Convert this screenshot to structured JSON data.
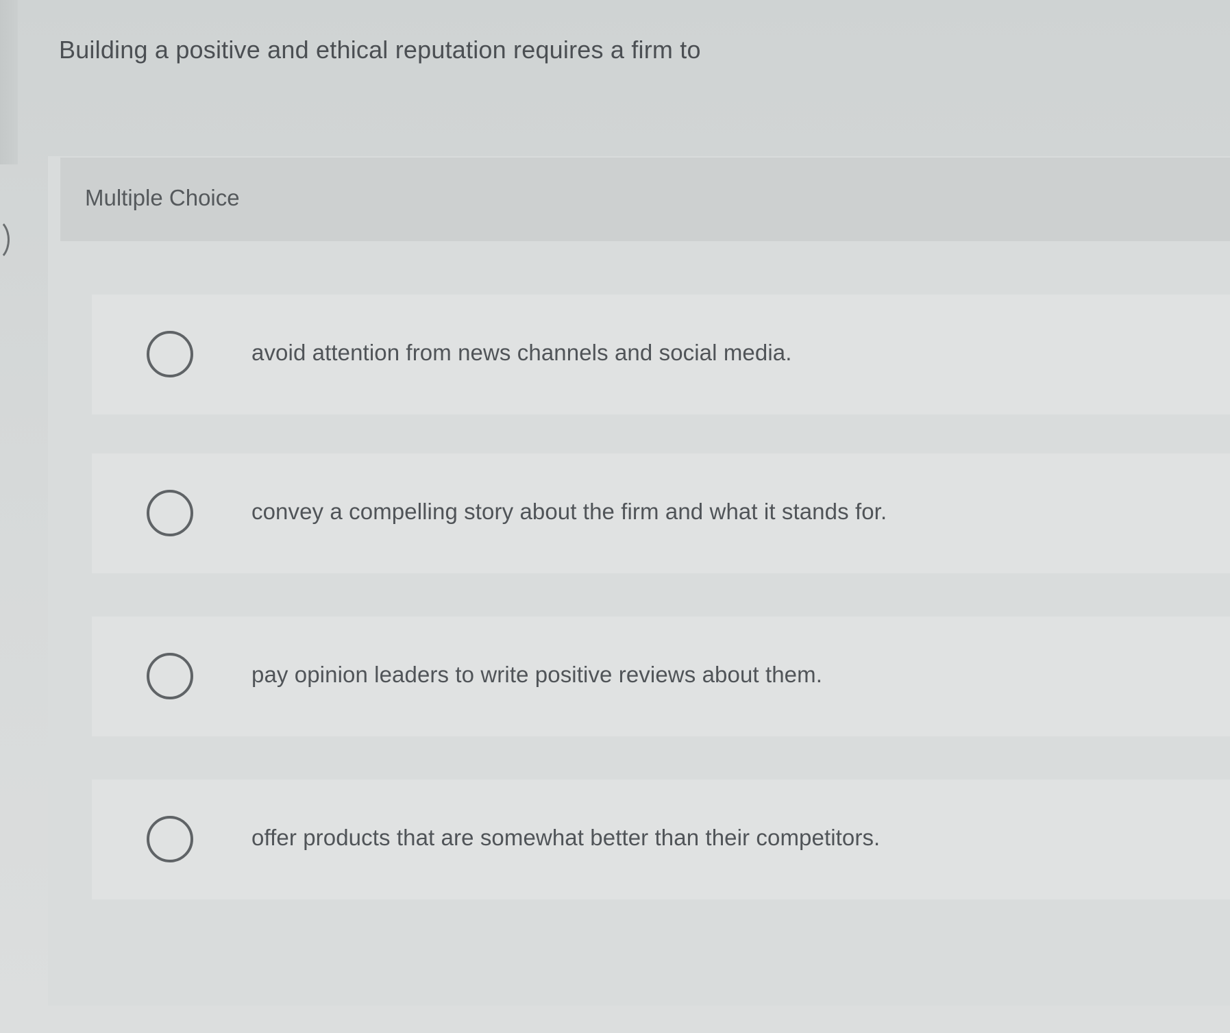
{
  "question": {
    "text": "Building a positive and ethical reputation requires a firm to"
  },
  "card": {
    "type_label": "Multiple Choice"
  },
  "options": [
    {
      "label": "avoid attention from news channels and social media."
    },
    {
      "label": "convey a compelling story about the firm and what it stands for."
    },
    {
      "label": "pay opinion leaders to write positive reviews about them."
    },
    {
      "label": "offer products that are somewhat better than their competitors."
    }
  ],
  "colors": {
    "background": "#d6d9d9",
    "card": "#d9dcdc",
    "card_header": "#cdd0d0",
    "option": "#e0e2e2",
    "text": "#4b4f53",
    "radio_border": "#5f6366"
  },
  "icons": {
    "radio": "radio-unselected-icon"
  }
}
